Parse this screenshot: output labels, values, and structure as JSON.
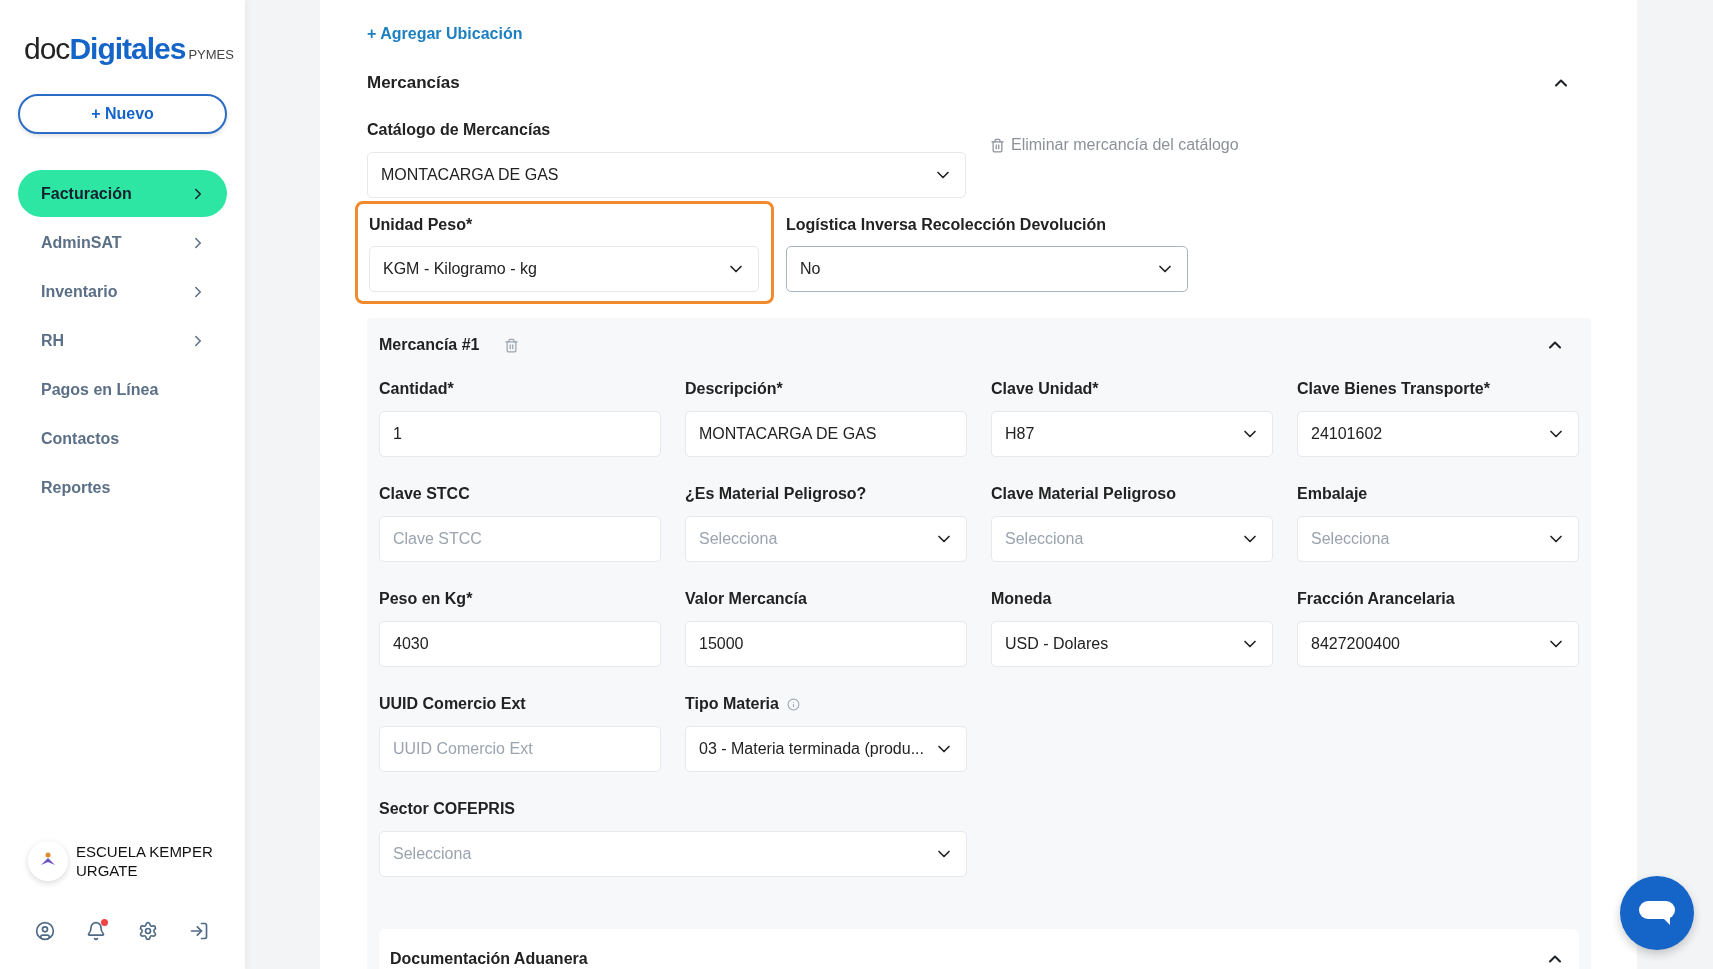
{
  "sidebar": {
    "logo": {
      "prefix": "doc",
      "main": "Digitales",
      "suffix": "PYMES"
    },
    "new_button": "+ Nuevo",
    "items": [
      {
        "label": "Facturación",
        "selected": true,
        "has_submenu": true
      },
      {
        "label": "AdminSAT",
        "selected": false,
        "has_submenu": true
      },
      {
        "label": "Inventario",
        "selected": false,
        "has_submenu": true
      },
      {
        "label": "RH",
        "selected": false,
        "has_submenu": true
      },
      {
        "label": "Pagos en Línea",
        "selected": false,
        "has_submenu": false
      },
      {
        "label": "Contactos",
        "selected": false,
        "has_submenu": false
      },
      {
        "label": "Reportes",
        "selected": false,
        "has_submenu": false
      }
    ],
    "account": {
      "name": "ESCUELA KEMPER URGATE"
    },
    "notifications_unread": true
  },
  "main": {
    "add_location": "+ Agregar Ubicación",
    "section": {
      "title": "Mercancías",
      "expanded": true
    },
    "catalog": {
      "label": "Catálogo de Mercancías",
      "value": "MONTACARGA DE GAS",
      "delete_action": "Eliminar mercancía del catálogo"
    },
    "top_fields": [
      {
        "label": "Unidad Peso*",
        "value": "KGM - Kilogramo - kg",
        "highlighted": true,
        "focused": false
      },
      {
        "label": "Logística Inversa Recolección Devolución",
        "value": "No",
        "highlighted": false,
        "focused": true
      }
    ],
    "item": {
      "title": "Mercancía #1",
      "expanded": true,
      "rows": [
        [
          {
            "label": "Cantidad*",
            "kind": "input",
            "value": "1"
          },
          {
            "label": "Descripción*",
            "kind": "input",
            "value": "MONTACARGA DE GAS"
          },
          {
            "label": "Clave Unidad*",
            "kind": "select",
            "value": "H87"
          },
          {
            "label": "Clave Bienes Transporte*",
            "kind": "select",
            "value": "24101602"
          }
        ],
        [
          {
            "label": "Clave STCC",
            "kind": "input",
            "placeholder": "Clave STCC"
          },
          {
            "label": "¿Es Material Peligroso?",
            "kind": "select",
            "placeholder": "Selecciona"
          },
          {
            "label": "Clave Material Peligroso",
            "kind": "select",
            "placeholder": "Selecciona"
          },
          {
            "label": "Embalaje",
            "kind": "select",
            "placeholder": "Selecciona"
          }
        ],
        [
          {
            "label": "Peso en Kg*",
            "kind": "input",
            "value": "4030"
          },
          {
            "label": "Valor Mercancía",
            "kind": "input",
            "value": "15000"
          },
          {
            "label": "Moneda",
            "kind": "select",
            "value": "USD - Dolares"
          },
          {
            "label": "Fracción Arancelaria",
            "kind": "select",
            "value": "8427200400"
          }
        ],
        [
          {
            "label": "UUID Comercio Ext",
            "kind": "input",
            "placeholder": "UUID Comercio Ext"
          },
          {
            "label": "Tipo Materia",
            "kind": "select",
            "value": "03 - Materia terminada (produ...",
            "info": true
          }
        ],
        [
          {
            "label": "Sector COFEPRIS",
            "kind": "select",
            "placeholder": "Selecciona",
            "wide": true
          }
        ]
      ]
    },
    "customs": {
      "title": "Documentación Aduanera",
      "expanded": true
    }
  }
}
